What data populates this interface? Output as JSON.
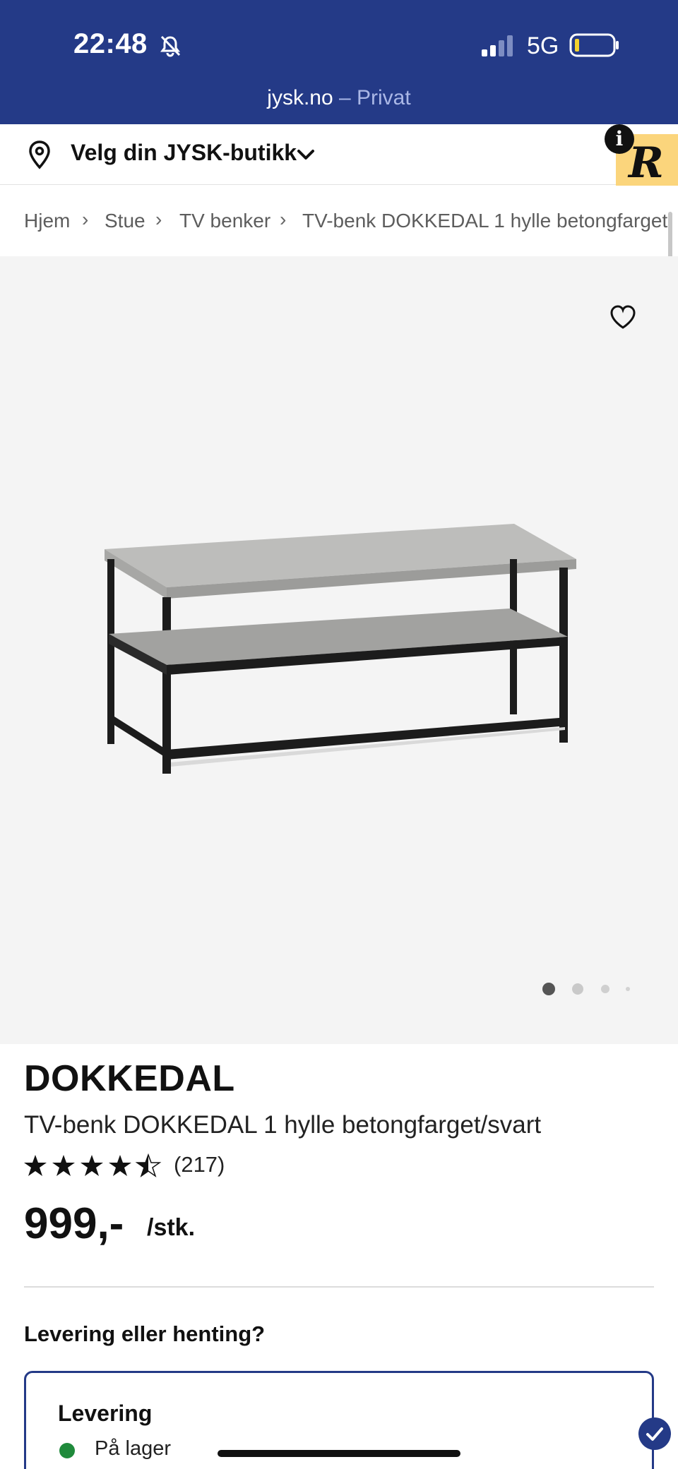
{
  "status_bar": {
    "time": "22:48",
    "network": "5G"
  },
  "browser": {
    "url_domain": "jysk.no",
    "url_separator": " – ",
    "url_mode": "Privat"
  },
  "store_selector": {
    "label": "Velg din JYSK-butikk",
    "icon": "location-pin-icon"
  },
  "badge": {
    "letter": "R",
    "info": "i"
  },
  "breadcrumb": {
    "items": [
      "Hjem",
      "Stue",
      "TV benker",
      "TV-benk DOKKEDAL 1 hylle betongfarget"
    ],
    "separator": "›"
  },
  "gallery": {
    "image_count": 4,
    "active_index": 0
  },
  "product": {
    "brand": "DOKKEDAL",
    "name": "TV-benk DOKKEDAL 1 hylle betongfarget/svart",
    "rating": 4.5,
    "rating_count": "(217)",
    "price": "999,-",
    "price_unit": "/stk."
  },
  "delivery": {
    "heading": "Levering eller henting?",
    "option_title": "Levering",
    "stock_status": "På lager",
    "stock_color": "#1f8a3b"
  },
  "colors": {
    "brand_blue": "#243a87",
    "badge_yellow": "#fbd57c"
  }
}
